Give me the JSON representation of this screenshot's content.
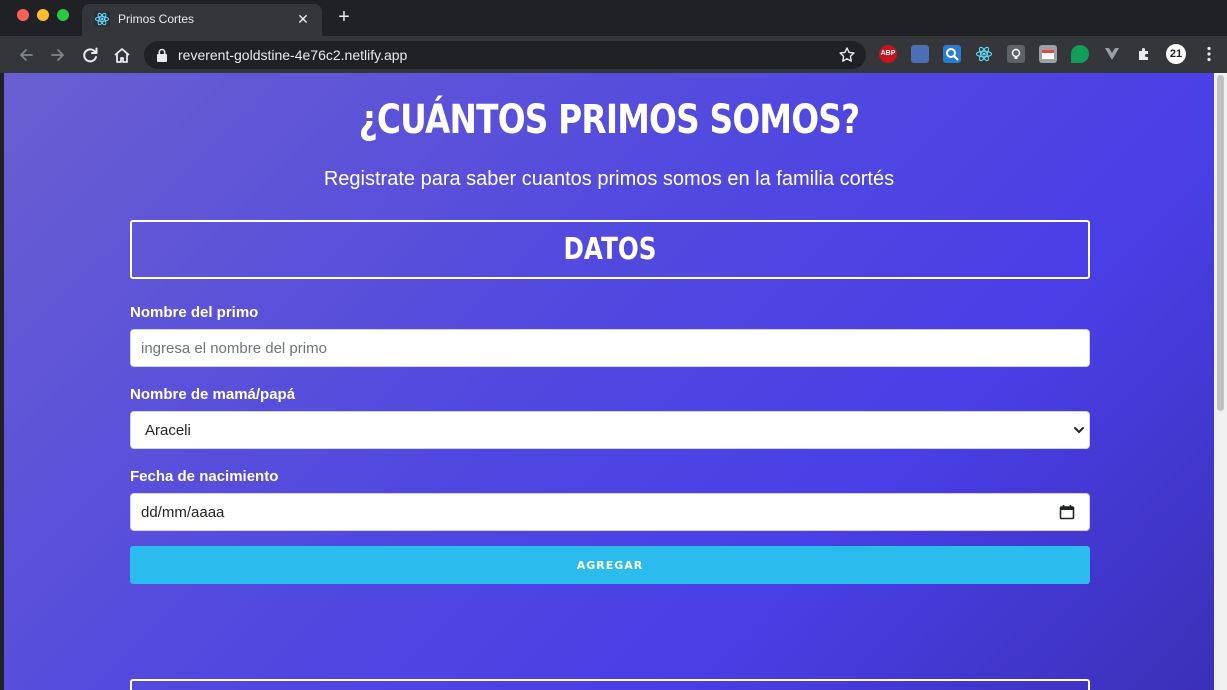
{
  "browser": {
    "tab_title": "Primos Cortes",
    "url": "reverent-goldstine-4e76c2.netlify.app",
    "extensions": {
      "abp": "ABP",
      "badge": "21"
    }
  },
  "page": {
    "headline": "¿CUÁNTOS PRIMOS SOMOS?",
    "subtitle": "Registrate para saber cuantos primos somos en la familia cortés",
    "section_title": "DATOS",
    "form": {
      "nombre_label": "Nombre del primo",
      "nombre_placeholder": "ingresa el nombre del primo",
      "padre_label": "Nombre de mamá/papá",
      "padre_value": "Araceli",
      "fecha_label": "Fecha de nacimiento",
      "fecha_value": "dd/mm/aaaa",
      "submit_label": "AGREGAR"
    }
  },
  "colors": {
    "accent_button": "#2bbbed",
    "background_start": "#6a5fd0",
    "background_end": "#3b30b8"
  }
}
